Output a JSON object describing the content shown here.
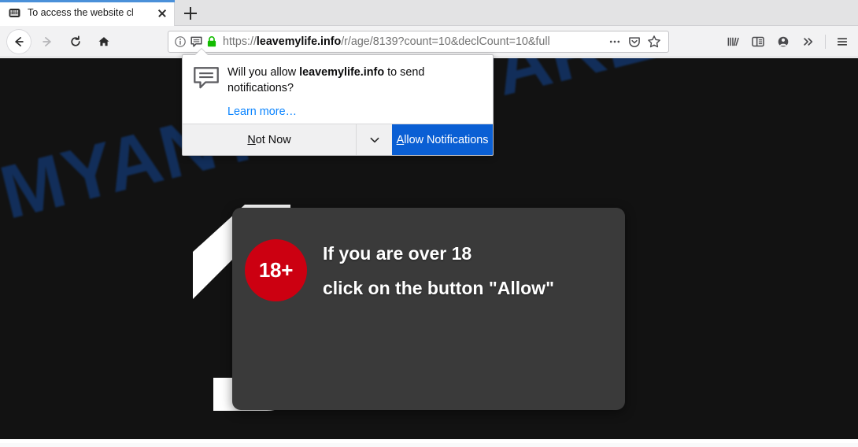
{
  "browser": {
    "tab": {
      "title": "To access the website cl",
      "favicon_icon": "keyboard-icon",
      "close_icon": "close-icon"
    },
    "new_tab_label": "+",
    "nav": {
      "back_icon": "back-arrow-icon",
      "forward_icon": "forward-arrow-icon",
      "reload_icon": "reload-icon",
      "home_icon": "home-icon"
    },
    "urlbar": {
      "info_icon": "identity-info-icon",
      "notification_icon": "notification-bubble-icon",
      "lock_icon": "padlock-icon",
      "scheme": "https://",
      "host": "leavemylife.info",
      "path": "/r/age/8139?count=10&declCount=10&full",
      "full_url": "https://leavemylife.info/r/age/8139?count=10&declCount=10&full",
      "page_actions_icon": "ellipsis-icon",
      "pocket_icon": "pocket-icon",
      "bookmark_icon": "star-icon"
    },
    "toolbar_right": {
      "library_icon": "library-icon",
      "sidebar_icon": "sidebar-icon",
      "account_icon": "account-icon",
      "overflow_icon": "chevron-double-right-icon",
      "menu_icon": "hamburger-menu-icon"
    },
    "accent_color": "#4a90d9"
  },
  "permission_prompt": {
    "icon": "notification-bubble-icon",
    "message_prefix": "Will you allow ",
    "message_host": "leavemylife.info",
    "message_suffix": " to send notifications?",
    "learn_more_label": "Learn more…",
    "not_now_label": "Not Now",
    "dropdown_icon": "chevron-down-icon",
    "allow_label": "Allow Notifications",
    "allow_button_color": "#0a5fd4",
    "link_color": "#0a84ff"
  },
  "page": {
    "background_color": "#121212",
    "watermark_text": "MYANTISPYWARE.COM",
    "watermark_color": "#12305e",
    "card": {
      "background_color": "#3a3a3a",
      "badge_label": "18+",
      "badge_color": "#cc0011",
      "line1": "If you are over 18",
      "line2": "click on the button \"Allow\""
    },
    "background_numeral": "1"
  }
}
